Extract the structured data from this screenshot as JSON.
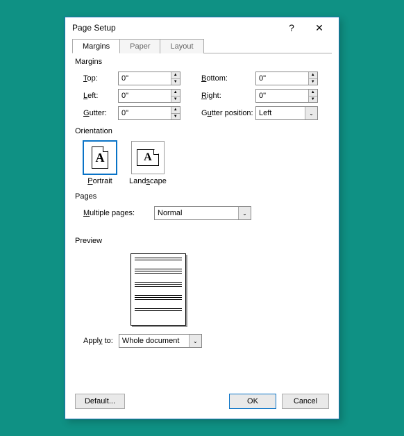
{
  "title": "Page Setup",
  "tabs": {
    "margins": "Margins",
    "paper": "Paper",
    "layout": "Layout"
  },
  "section": {
    "margins": "Margins",
    "orientation": "Orientation",
    "pages": "Pages",
    "preview": "Preview"
  },
  "margins": {
    "topLabel": "Top:",
    "topValue": "0\"",
    "bottomLabel": "Bottom:",
    "bottomValue": "0\"",
    "leftLabel": "Left:",
    "leftValue": "0\"",
    "rightLabel": "Right:",
    "rightValue": "0\"",
    "gutterLabel": "Gutter:",
    "gutterValue": "0\"",
    "gutterPosLabel": "Gutter position:",
    "gutterPosValue": "Left"
  },
  "orientation": {
    "portrait": "Portrait",
    "landscape": "Landscape",
    "glyph": "A"
  },
  "pages": {
    "multipleLabel": "Multiple pages:",
    "multipleValue": "Normal"
  },
  "apply": {
    "label": "Apply to:",
    "value": "Whole document"
  },
  "buttons": {
    "default": "Default...",
    "ok": "OK",
    "cancel": "Cancel",
    "help": "?",
    "close": "✕"
  }
}
